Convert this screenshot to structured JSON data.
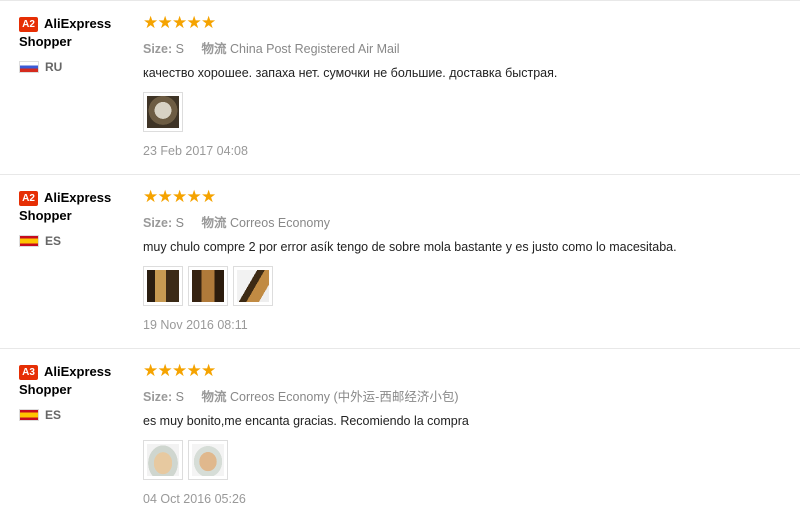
{
  "reviews": [
    {
      "level": "A2",
      "user_name_1": "AliExpress",
      "user_name_2": "Shopper",
      "country": "RU",
      "flag": "ru",
      "stars": 5,
      "size_label": "Size:",
      "size_value": "S",
      "logistics_label": "物流",
      "logistics_value": "China Post Registered Air Mail",
      "text": "качество хорошее. запаха нет. сумочки не большие. доставка быстрая.",
      "photo_count": 1,
      "date": "23 Feb 2017 04:08"
    },
    {
      "level": "A2",
      "user_name_1": "AliExpress",
      "user_name_2": "Shopper",
      "country": "ES",
      "flag": "es",
      "stars": 5,
      "size_label": "Size:",
      "size_value": "S",
      "logistics_label": "物流",
      "logistics_value": "Correos Economy",
      "text": "muy chulo compre 2 por error asík tengo de sobre mola bastante y es justo como lo macesitaba.",
      "photo_count": 3,
      "date": "19 Nov 2016 08:11"
    },
    {
      "level": "A3",
      "user_name_1": "AliExpress",
      "user_name_2": "Shopper",
      "country": "ES",
      "flag": "es",
      "stars": 5,
      "size_label": "Size:",
      "size_value": "S",
      "logistics_label": "物流",
      "logistics_value": "Correos Economy (中外运-西邮经济小包)",
      "text": "es muy bonito,me encanta gracias. Recomiendo la compra",
      "photo_count": 2,
      "date": "04 Oct 2016 05:26"
    }
  ],
  "star_glyph": "★",
  "colors": {
    "star": "#f5a300",
    "badge": "#e62e04"
  }
}
